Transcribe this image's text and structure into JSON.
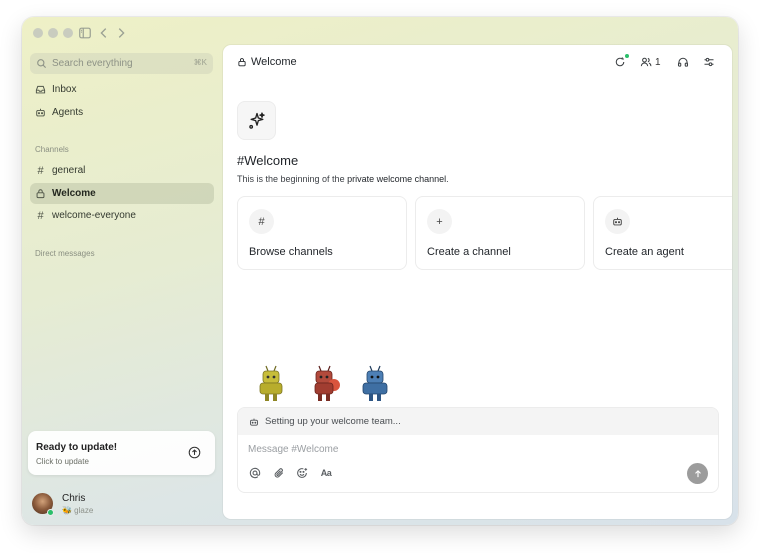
{
  "window": {
    "traffic_lights": [
      "close",
      "minimize",
      "zoom"
    ],
    "toolbar_icons": [
      "sidebar-toggle-icon",
      "back-icon",
      "forward-icon"
    ]
  },
  "sidebar": {
    "search": {
      "placeholder": "Search everything",
      "shortcut": "⌘K"
    },
    "top_items": [
      {
        "label": "Inbox",
        "icon": "inbox-icon"
      },
      {
        "label": "Agents",
        "icon": "robot-icon"
      }
    ],
    "channels_label": "Channels",
    "channels": [
      {
        "label": "general",
        "icon": "hash-icon",
        "active": false
      },
      {
        "label": "Welcome",
        "icon": "lock-icon",
        "active": true
      },
      {
        "label": "welcome-everyone",
        "icon": "hash-icon",
        "active": false
      }
    ],
    "dm_label": "Direct messages",
    "update": {
      "title": "Ready to update!",
      "subtitle": "Click to update"
    },
    "user": {
      "name": "Chris",
      "status": "🐝 glaze",
      "online": true
    }
  },
  "main": {
    "channel_title": "Welcome",
    "member_count": "1",
    "hero": {
      "title": "#Welcome",
      "subtitle_prefix": "This is the beginning of the ",
      "subtitle_emphasis": "private welcome channel",
      "subtitle_suffix": "."
    },
    "actions": [
      {
        "label": "Browse channels",
        "icon": "hash-icon"
      },
      {
        "label": "Create a channel",
        "icon": "plus-icon"
      },
      {
        "label": "Create an agent",
        "icon": "robot-icon"
      }
    ],
    "composer": {
      "banner": "Setting up your welcome team...",
      "placeholder": "Message #Welcome"
    }
  },
  "colors": {
    "sidebar_gradient_top": "#eef0c6",
    "sidebar_gradient_bottom": "#d8e2ea",
    "online": "#2bbf6a",
    "send_button": "#9c9c9c"
  }
}
